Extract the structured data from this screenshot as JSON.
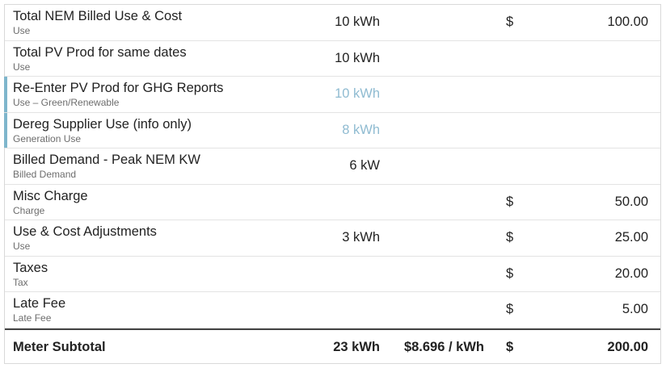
{
  "rows": [
    {
      "label": "Total NEM Billed Use & Cost",
      "sub": "Use",
      "use": "10 kWh",
      "cur": "$",
      "amount": "100.00",
      "accent": false,
      "muted": false
    },
    {
      "label": "Total PV Prod for same dates",
      "sub": "Use",
      "use": "10 kWh",
      "cur": "",
      "amount": "",
      "accent": false,
      "muted": false
    },
    {
      "label": "Re-Enter PV Prod for GHG Reports",
      "sub": "Use – Green/Renewable",
      "use": "10 kWh",
      "cur": "",
      "amount": "",
      "accent": true,
      "muted": true
    },
    {
      "label": "Dereg Supplier Use (info only)",
      "sub": "Generation Use",
      "use": "8 kWh",
      "cur": "",
      "amount": "",
      "accent": true,
      "muted": true
    },
    {
      "label": "Billed Demand - Peak NEM KW",
      "sub": "Billed Demand",
      "use": "6 kW",
      "cur": "",
      "amount": "",
      "accent": false,
      "muted": false
    },
    {
      "label": "Misc Charge",
      "sub": "Charge",
      "use": "",
      "cur": "$",
      "amount": "50.00",
      "accent": false,
      "muted": false
    },
    {
      "label": "Use & Cost Adjustments",
      "sub": "Use",
      "use": "3 kWh",
      "cur": "$",
      "amount": "25.00",
      "accent": false,
      "muted": false
    },
    {
      "label": "Taxes",
      "sub": "Tax",
      "use": "",
      "cur": "$",
      "amount": "20.00",
      "accent": false,
      "muted": false
    },
    {
      "label": "Late Fee",
      "sub": "Late Fee",
      "use": "",
      "cur": "$",
      "amount": "5.00",
      "accent": false,
      "muted": false
    }
  ],
  "total": {
    "label": "Meter Subtotal",
    "use": "23 kWh",
    "rate": "$8.696 / kWh",
    "cur": "$",
    "amount": "200.00"
  },
  "colors": {
    "accent": "#7fb6cc",
    "muted_value": "#8fbbd1",
    "border": "#e3e3e3",
    "total_rule": "#444444"
  }
}
